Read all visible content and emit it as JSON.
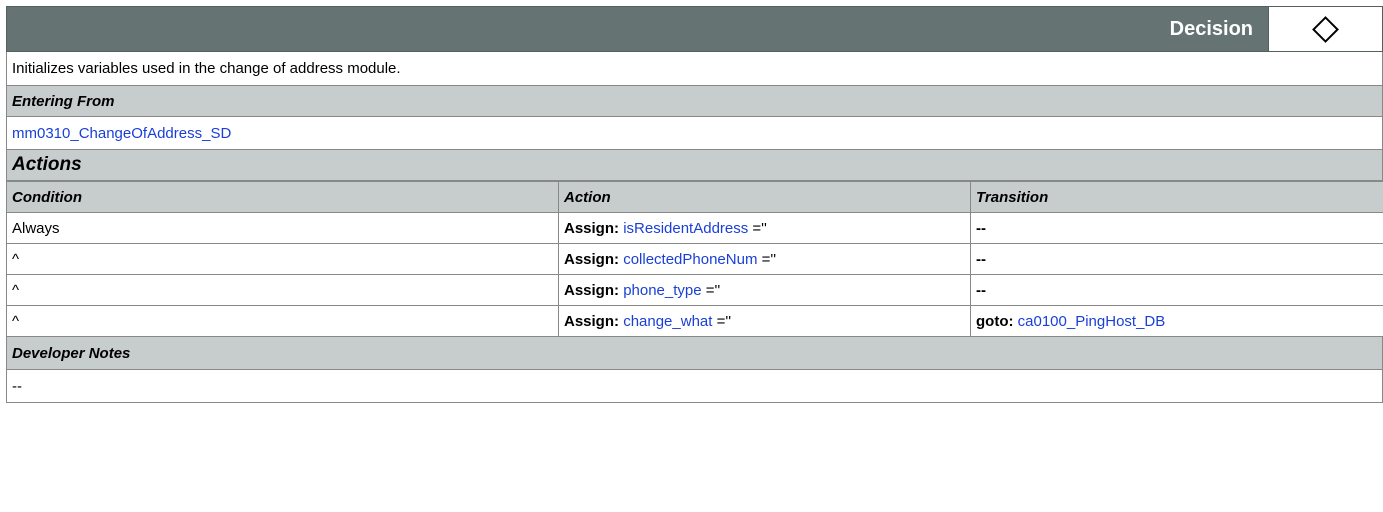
{
  "node": {
    "type_label": "Decision",
    "icon": "decision-diamond-icon",
    "description": "Initializes variables used in the change of address module."
  },
  "entering_from": {
    "heading": "Entering From",
    "link": "mm0310_ChangeOfAddress_SD"
  },
  "actions": {
    "heading": "Actions",
    "columns": [
      "Condition",
      "Action",
      "Transition"
    ],
    "rows": [
      {
        "condition": "Always",
        "assign_label": "Assign:",
        "variable": "isResidentAddress",
        "value": " =''",
        "transition": "--",
        "transition_link": ""
      },
      {
        "condition": "^",
        "assign_label": "Assign:",
        "variable": "collectedPhoneNum",
        "value": " =''",
        "transition": "--",
        "transition_link": ""
      },
      {
        "condition": "^",
        "assign_label": "Assign:",
        "variable": "phone_type",
        "value": " =''",
        "transition": "--",
        "transition_link": ""
      },
      {
        "condition": "^",
        "assign_label": "Assign:",
        "variable": "change_what",
        "value": " =''",
        "transition": "goto:",
        "transition_link": "ca0100_PingHost_DB"
      }
    ]
  },
  "developer_notes": {
    "heading": "Developer Notes",
    "text": "--"
  }
}
